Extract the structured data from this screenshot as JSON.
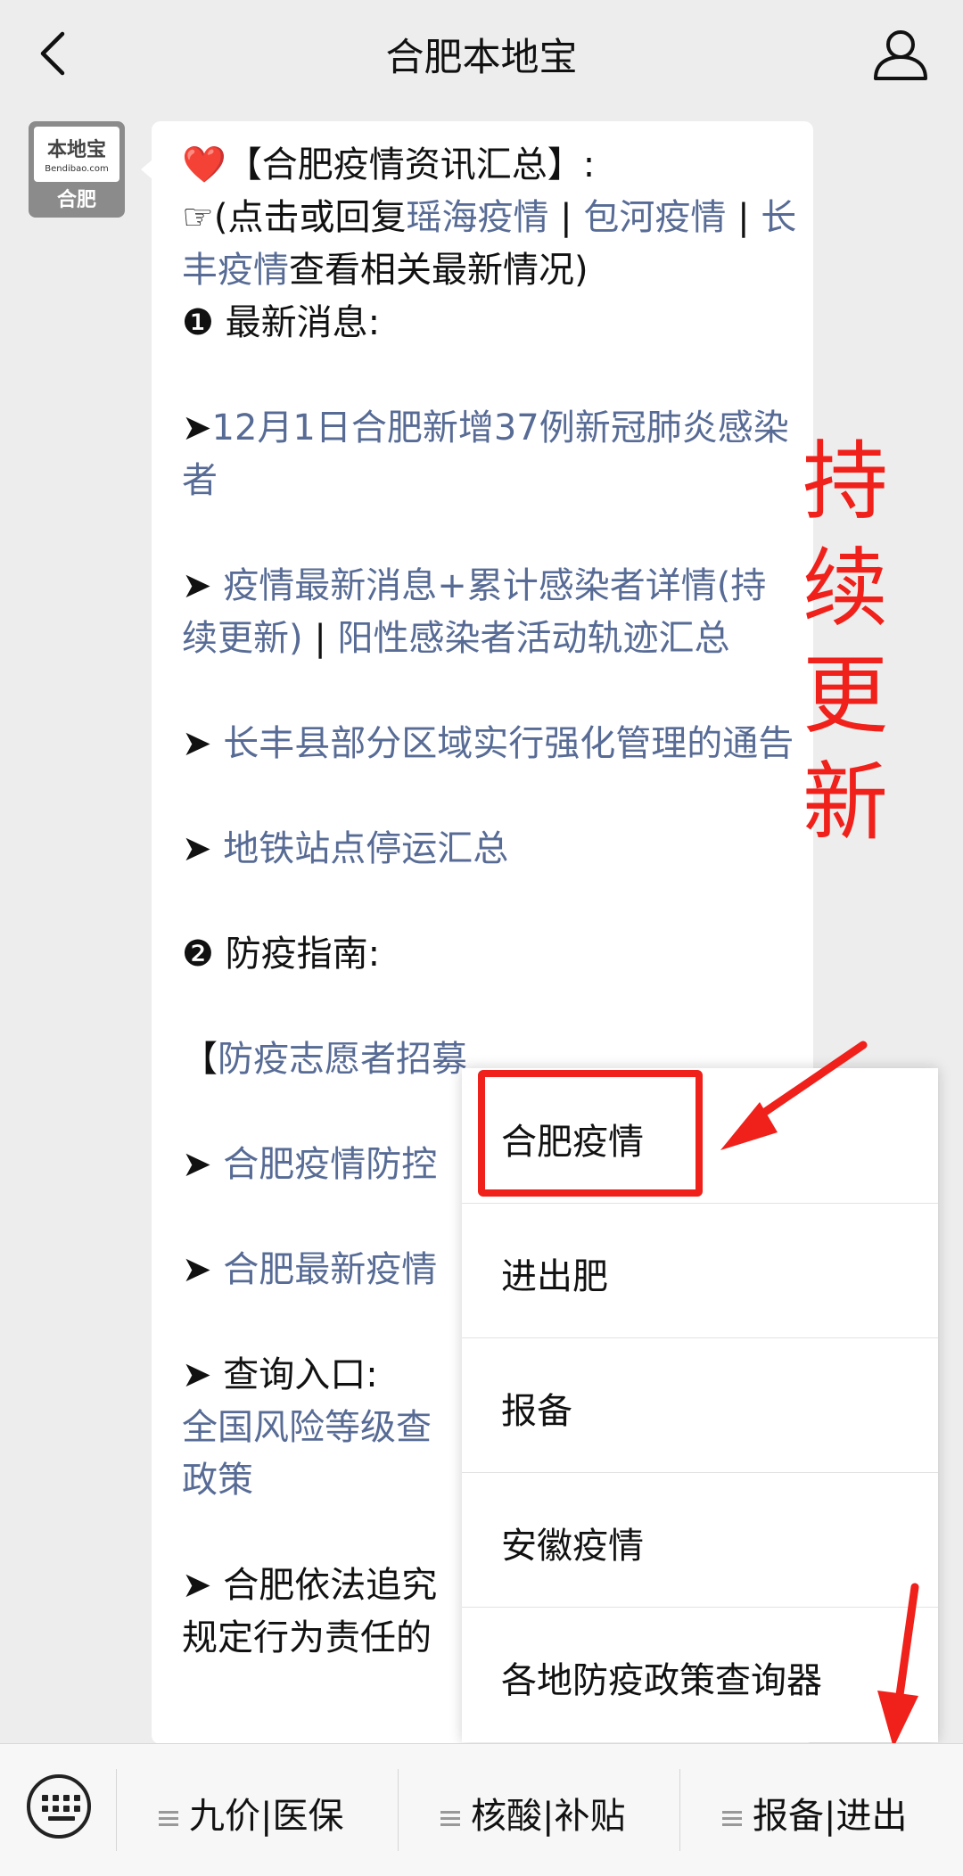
{
  "header": {
    "title": "合肥本地宝"
  },
  "avatar": {
    "logo": "本地宝",
    "url": "Bendibao.com",
    "city": "合肥"
  },
  "message": {
    "heart": "❤️",
    "heading": "【合肥疫情资讯汇总】:",
    "pointer": "☞",
    "hint_open": "(点击或回复",
    "link_yaohai": "瑶海疫情",
    "sep": " | ",
    "link_baohe": "包河疫情",
    "link_changfeng": "长丰疫情",
    "hint_close": "查看相关最新情况)",
    "section1": "❶ 最新消息:",
    "arrow": "➤",
    "news1": "12月1日合肥新增37例新冠肺炎感染者",
    "news2": "疫情最新消息+累计感染者详情(持续更新)",
    "news2_sep": " | ",
    "news2b": "阳性感染者活动轨迹汇总",
    "news3": "长丰县部分区域实行强化管理的通告",
    "news4": "地铁站点停运汇总",
    "section2": "❷ 防疫指南:",
    "volunteer_open": "【",
    "volunteer": "防疫志愿者招募",
    "guide1": "合肥疫情防控",
    "guide2": "合肥最新疫情",
    "query": "查询入口:",
    "query_link": "全国风险等级查",
    "policy": "政策",
    "legal": "合肥依法追究",
    "legal2": "规定行为责任的"
  },
  "annotation": {
    "red_text": [
      "持",
      "续",
      "更",
      "新"
    ]
  },
  "popup_menu": {
    "items": [
      "合肥疫情",
      "进出肥",
      "报备",
      "安徽疫情",
      "各地防疫政策查询器"
    ]
  },
  "bottom_bar": {
    "tabs": [
      "九价|医保",
      "核酸|补贴",
      "报备|进出"
    ]
  },
  "colors": {
    "link": "#576b95",
    "annotation_red": "#f0201a",
    "background": "#ededed"
  }
}
